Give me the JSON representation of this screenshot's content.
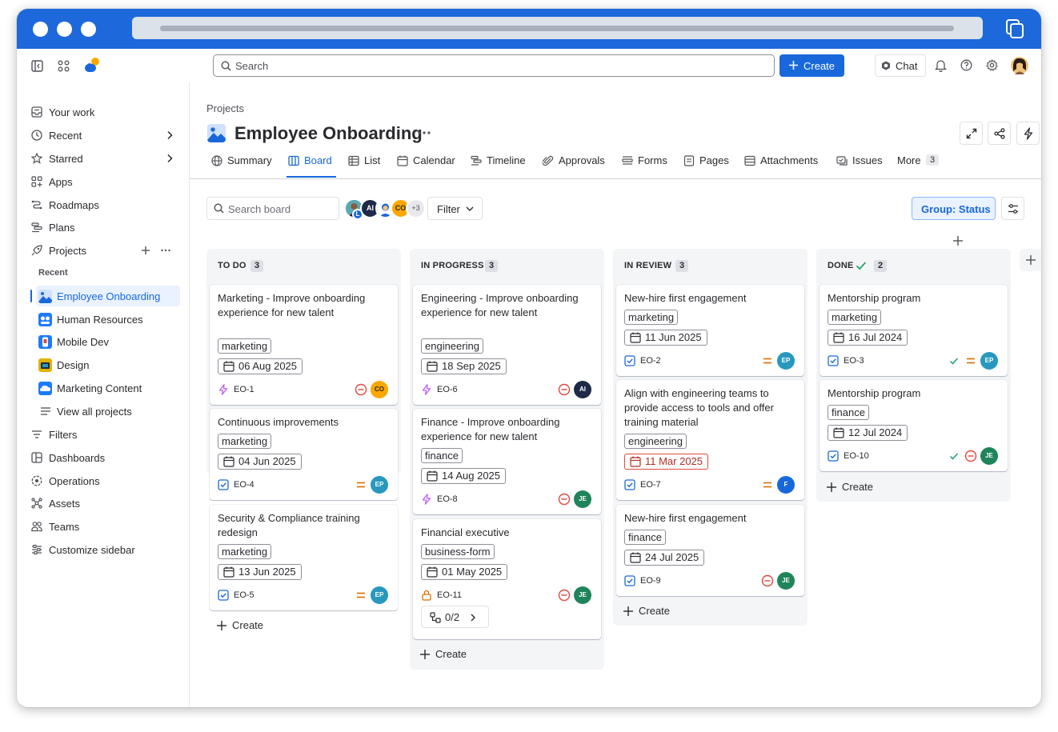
{
  "topbar": {
    "search_placeholder": "Search",
    "create_label": "Create",
    "chat_label": "Chat"
  },
  "sidebar": {
    "items": [
      {
        "label": "Your work",
        "icon": "inbox-icon"
      },
      {
        "label": "Recent",
        "icon": "clock-icon"
      },
      {
        "label": "Starred",
        "icon": "star-icon"
      },
      {
        "label": "Apps",
        "icon": "apps-icon"
      },
      {
        "label": "Roadmaps",
        "icon": "roadmap-icon"
      },
      {
        "label": "Plans",
        "icon": "plans-icon"
      },
      {
        "label": "Projects",
        "icon": "rocket-icon"
      }
    ],
    "recent_label": "Recent",
    "projects": [
      {
        "label": "Employee Onboarding",
        "color": "#1868db"
      },
      {
        "label": "Human Resources",
        "color": "#1d7afc"
      },
      {
        "label": "Mobile Dev",
        "color": "#1d7afc"
      },
      {
        "label": "Design",
        "color": "#e2b203"
      },
      {
        "label": "Marketing Content",
        "color": "#1d7afc"
      }
    ],
    "view_all": "View all projects",
    "bottom_items": [
      {
        "label": "Filters",
        "icon": "filter-icon"
      },
      {
        "label": "Dashboards",
        "icon": "dashboard-icon"
      },
      {
        "label": "Operations",
        "icon": "operations-icon"
      },
      {
        "label": "Assets",
        "icon": "assets-icon"
      },
      {
        "label": "Teams",
        "icon": "teams-icon"
      },
      {
        "label": "Customize sidebar",
        "icon": "customize-icon"
      }
    ]
  },
  "header": {
    "breadcrumb": "Projects",
    "title": "Employee Onboarding"
  },
  "tabs": [
    {
      "label": "Summary"
    },
    {
      "label": "Board",
      "active": true
    },
    {
      "label": "List"
    },
    {
      "label": "Calendar"
    },
    {
      "label": "Timeline"
    },
    {
      "label": "Approvals"
    },
    {
      "label": "Forms"
    },
    {
      "label": "Pages"
    },
    {
      "label": "Attachments"
    },
    {
      "label": "Issues"
    },
    {
      "label": "More",
      "count": "3"
    }
  ],
  "toolbar": {
    "search_placeholder": "Search board",
    "avatars": [
      "L",
      "AI",
      "",
      "CO"
    ],
    "more_avatars": "+3",
    "filter_label": "Filter",
    "group_label": "Group: Status"
  },
  "columns": [
    {
      "title": "TO DO",
      "count": "3",
      "cards": [
        {
          "title": "Marketing - Improve onboarding experience for new talent",
          "tag": "marketing",
          "date": "06 Aug 2025",
          "key": "EO-1",
          "type": "epic",
          "priority": "blocker",
          "assignee": "CO",
          "assignee_color": "#fca700"
        },
        {
          "title": "Continuous improvements",
          "tag": "marketing",
          "date": "04 Jun 2025",
          "key": "EO-4",
          "type": "task",
          "priority": "medium",
          "assignee": "EP",
          "assignee_color": "#2898bd"
        },
        {
          "title": "Security & Compliance training redesign",
          "tag": "marketing",
          "date": "13 Jun 2025",
          "key": "EO-5",
          "type": "task",
          "priority": "medium",
          "assignee": "EP",
          "assignee_color": "#2898bd"
        }
      ],
      "create_label": "Create"
    },
    {
      "title": "IN PROGRESS",
      "count": "3",
      "cards": [
        {
          "title": "Engineering - Improve onboarding experience for new talent",
          "tag": "engineering",
          "date": "18 Sep 2025",
          "key": "EO-6",
          "type": "epic",
          "priority": "blocker",
          "assignee": "AI",
          "assignee_color": "#1e2a47"
        },
        {
          "title": "Finance - Improve onboarding experience for new talent",
          "tag": "finance",
          "date": "14 Aug 2025",
          "key": "EO-8",
          "type": "epic",
          "priority": "blocker",
          "assignee": "JE",
          "assignee_color": "#1f845a"
        },
        {
          "title": "Financial executive",
          "tag": "business-form",
          "date": "01 May 2025",
          "key": "EO-11",
          "type": "lock",
          "priority": "blocker",
          "assignee": "JE",
          "assignee_color": "#1f845a",
          "subtasks": "0/2"
        }
      ],
      "create_label": "Create"
    },
    {
      "title": "IN REVIEW",
      "count": "3",
      "cards": [
        {
          "title": "New-hire first engagement",
          "tag": "marketing",
          "date": "11 Jun 2025",
          "key": "EO-2",
          "type": "task",
          "priority": "medium",
          "assignee": "EP",
          "assignee_color": "#2898bd"
        },
        {
          "title": "Align with engineering teams to provide access to tools and offer training material",
          "tag": "engineering",
          "date": "11 Mar 2025",
          "overdue": true,
          "key": "EO-7",
          "type": "task",
          "priority": "medium",
          "assignee": "F",
          "assignee_color": "#1868db"
        },
        {
          "title": "New-hire first engagement",
          "tag": "finance",
          "date": "24 Jul 2025",
          "key": "EO-9",
          "type": "task",
          "priority": "blocker",
          "assignee": "JE",
          "assignee_color": "#1f845a"
        }
      ],
      "create_label": "Create"
    },
    {
      "title": "DONE",
      "count": "2",
      "cards": [
        {
          "title": "Mentorship program",
          "tag": "marketing",
          "date": "16 Jul 2024",
          "key": "EO-3",
          "type": "task",
          "priority": "medium",
          "done": true,
          "assignee": "EP",
          "assignee_color": "#2898bd"
        },
        {
          "title": "Mentorship program",
          "tag": "finance",
          "date": "12 Jul 2024",
          "key": "EO-10",
          "type": "task",
          "priority": "blocker",
          "done": true,
          "assignee": "JE",
          "assignee_color": "#1f845a"
        }
      ],
      "create_label": "Create"
    }
  ],
  "colors": {
    "brand": "#1868db",
    "chrome": "#1d68db",
    "blocker": "#e2483d",
    "medium": "#e06c00",
    "done_green": "#22a06b",
    "epic": "#bf63f3"
  }
}
